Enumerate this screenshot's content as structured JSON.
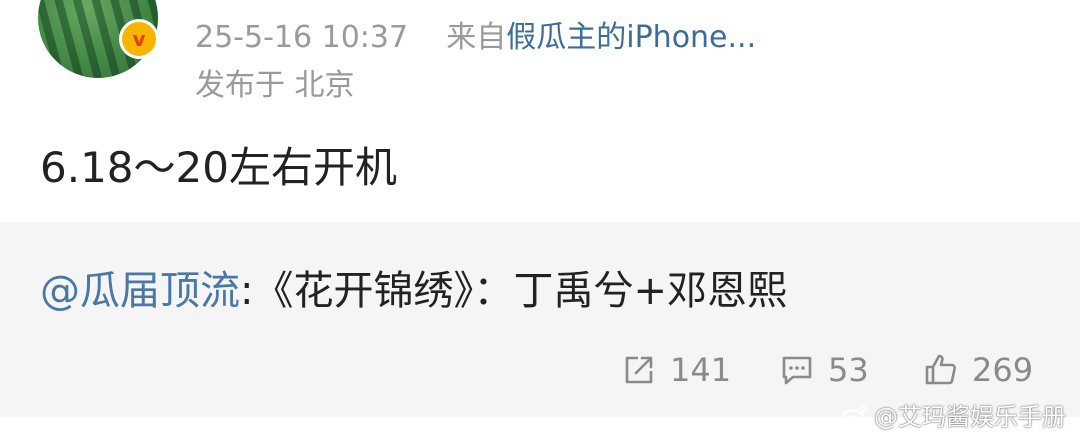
{
  "header": {
    "timestamp": "25-5-16 10:37",
    "source_prefix": "来自",
    "source_name": "假瓜主的iPhone...",
    "location": "发布于 北京",
    "badge": "v"
  },
  "post": {
    "text": "6.18～20左右开机"
  },
  "repost": {
    "mention": "@瓜届顶流",
    "content": ":《花开锦绣》：丁禹兮+邓恩熙"
  },
  "stats": {
    "reposts": "141",
    "comments": "53",
    "likes": "269"
  },
  "watermark": {
    "text": "@艾玛酱娱乐手册"
  },
  "icons": {
    "repost": "share-icon",
    "comment": "comment-icon",
    "like": "thumbs-up-icon",
    "watermark": "weibo-icon"
  }
}
